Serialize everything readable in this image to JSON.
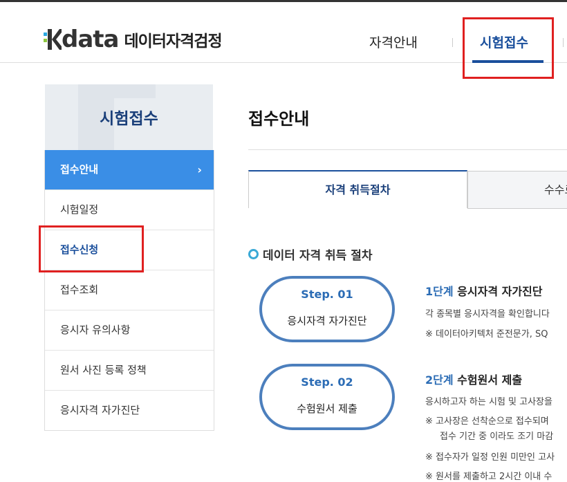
{
  "header": {
    "logo_text": "data",
    "logo_sub": "데이터자격검정",
    "nav": [
      "자격안내",
      "시험접수"
    ]
  },
  "sidebar": {
    "title": "시험접수",
    "items": [
      {
        "label": "접수안내",
        "chevron": "›"
      },
      {
        "label": "시험일정"
      },
      {
        "label": "접수신청"
      },
      {
        "label": "접수조회"
      },
      {
        "label": "응시자 유의사항"
      },
      {
        "label": "원서 사진 등록 정책"
      },
      {
        "label": "응시자격 자가진단"
      }
    ]
  },
  "main": {
    "title": "접수안내",
    "tabs": [
      "자격 취득절차",
      "수수료"
    ],
    "section_title": "데이터 자격 취득 절차",
    "steps": [
      {
        "badge": "Step. 01",
        "name": "응시자격 자가진단",
        "head_num": "1단계",
        "head_text": "응시자격 자가진단",
        "lines": [
          "각 종목별 응시자격을 확인합니다",
          "※ 데이터아키텍처 준전문가, SQ"
        ]
      },
      {
        "badge": "Step. 02",
        "name": "수험원서 제출",
        "head_num": "2단계",
        "head_text": "수험원서 제출",
        "lines": [
          "응시하고자 하는 시험 및 고사장을",
          "※ 고사장은 선착순으로 접수되며",
          "접수 기간 중 이라도 조기 마감",
          "※ 접수자가 일정 인원 미만인 고사",
          "※ 원서를 제출하고 2시간 이내 수"
        ]
      }
    ]
  },
  "colors": {
    "brand": "#1a4f9c",
    "accent": "#3a8ee6",
    "highlight": "#e02020"
  }
}
